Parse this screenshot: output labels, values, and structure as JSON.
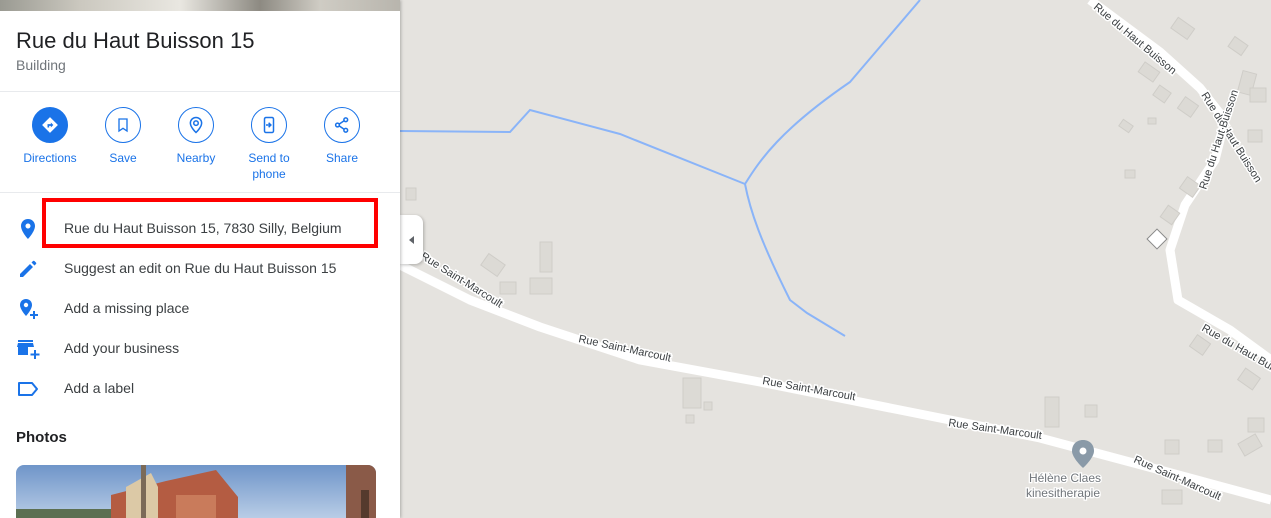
{
  "place": {
    "title": "Rue du Haut Buisson 15",
    "category": "Building"
  },
  "actions": [
    {
      "label": "Directions",
      "icon": "directions-icon"
    },
    {
      "label": "Save",
      "icon": "bookmark-icon"
    },
    {
      "label": "Nearby",
      "icon": "nearby-icon"
    },
    {
      "label": "Send to phone",
      "icon": "send-to-phone-icon"
    },
    {
      "label": "Share",
      "icon": "share-icon"
    }
  ],
  "info_rows": [
    {
      "text": "Rue du Haut Buisson 15, 7830 Silly, Belgium",
      "icon": "location-pin-icon"
    },
    {
      "text": "Suggest an edit on Rue du Haut Buisson 15",
      "icon": "pencil-icon"
    },
    {
      "text": "Add a missing place",
      "icon": "add-place-icon"
    },
    {
      "text": "Add your business",
      "icon": "add-business-icon"
    },
    {
      "text": "Add a label",
      "icon": "label-icon"
    }
  ],
  "photos": {
    "heading": "Photos"
  },
  "map": {
    "road_labels": {
      "haut_buisson_1": "Rue du Haut Buisson",
      "haut_buisson_2": "Rue du Haut Buisson",
      "haut_buisson_3": "Rue du Haut Buisson",
      "saint_marcoult_1": "Rue Saint-Marcoult",
      "saint_marcoult_2": "Rue Saint-Marcoult",
      "saint_marcoult_3": "Rue Saint-Marcoult",
      "saint_marcoult_4": "Rue Saint-Marcoult",
      "saint_marcoult_5": "Rue Saint-Marcoult"
    },
    "poi": {
      "name_line1": "Hélène Claes",
      "name_line2": "kinesitherapie"
    }
  },
  "colors": {
    "accent": "#1a73e8",
    "highlight": "#ff0000",
    "map_background": "#e5e3df",
    "water": "#8ab4f8"
  }
}
